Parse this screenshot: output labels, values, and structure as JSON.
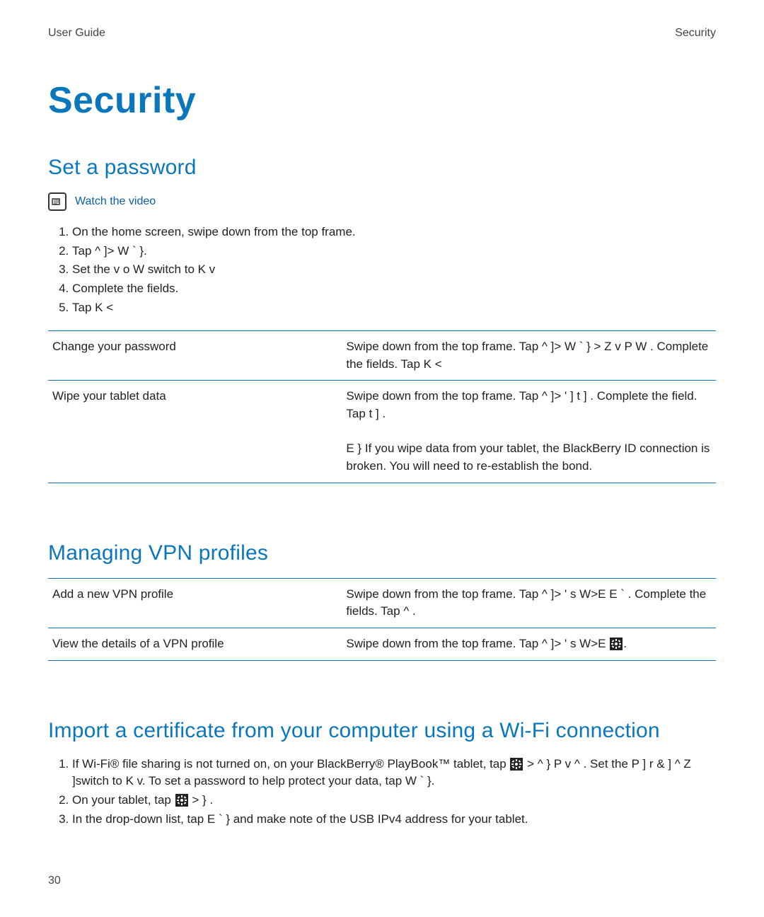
{
  "header": {
    "left": "User Guide",
    "right": "Security"
  },
  "title": "Security",
  "set_password": {
    "heading": "Set a password",
    "watch_label": "Watch the video",
    "steps": [
      "On the home screen, swipe down from the top frame.",
      "Tap  ^        ]> W         ` }.",
      "Set the   v    o   W      switch to  K v",
      "Complete the fields.",
      "Tap  K <"
    ],
    "table": [
      {
        "left": "Change your password",
        "right": "Swipe down from the top frame. Tap  ^        ]> W       ` } >  Z   v P   W       . Complete the fields. Tap  K <"
      },
      {
        "left": "Wipe your tablet data",
        "right": "Swipe down from the top frame. Tap  ^        ]>  '    ]       t ]  . Complete the field. Tap  t ]        .",
        "note": "E }    If you wipe data from your tablet, the BlackBerry ID connection is broken. You will need to re-establish the bond."
      }
    ]
  },
  "vpn": {
    "heading": "Managing VPN profiles",
    "table": [
      {
        "left": "Add a new VPN profile",
        "right": "Swipe down from the top frame. Tap  ^        ]>  ' s W>E     E    ` . Complete the fields. Tap  ^     ."
      },
      {
        "left": "View the details of a VPN profile",
        "right_pre": "Swipe down from the top frame. Tap  ^        ]>  ' s W>E",
        "right_post": "."
      }
    ]
  },
  "cert": {
    "heading": "Import a certificate from your computer using a Wi-Fi connection",
    "step1_pre": "If Wi-Fi® file sharing is not turned on, on your BlackBerry® PlayBook™ tablet, tap ",
    "step1_post": " >  ^    }    P     v    ^ . Set the  P ] r & ]    ^ Z    ]switch to  K v. To set a password to help protect your data, tap  W       ` }.",
    "step2_pre": "On your tablet, tap ",
    "step2_post": " >     }    .",
    "step3": "In the drop-down list, tap  E    ` }   and make note of the USB IPv4 address for your tablet."
  },
  "page_number": "30"
}
